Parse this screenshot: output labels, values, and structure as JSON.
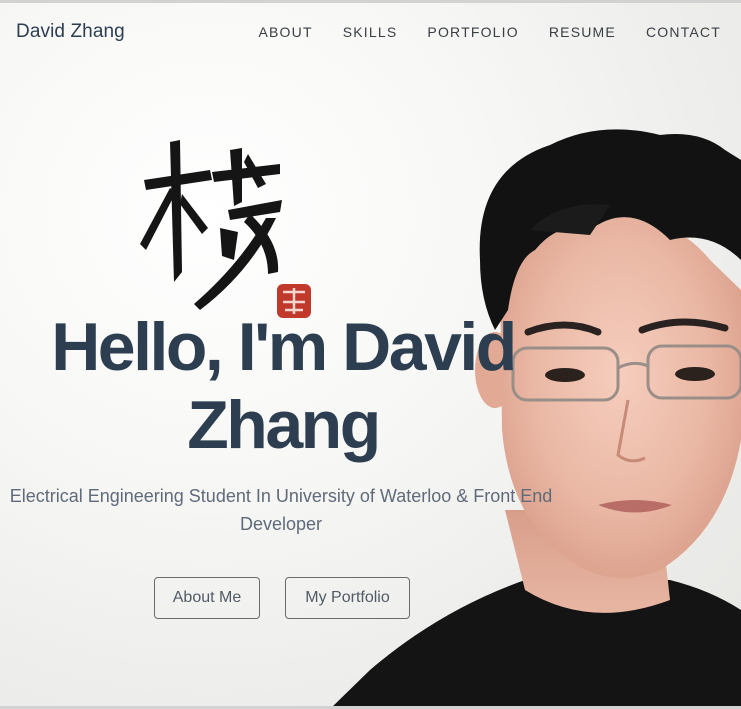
{
  "navbar": {
    "brand": "David Zhang",
    "links": [
      "ABOUT",
      "SKILLS",
      "PORTFOLIO",
      "RESUME",
      "CONTACT"
    ]
  },
  "hero": {
    "headline": "Hello, I'm David Zhang",
    "subtitle": "Electrical Engineering Student In University of Waterloo & Front End Developer",
    "buttons": {
      "about": "About Me",
      "portfolio": "My Portfolio"
    }
  },
  "colors": {
    "heading": "#2c3e50",
    "subtitle": "#5f6b7a",
    "seal": "#c0392b"
  }
}
